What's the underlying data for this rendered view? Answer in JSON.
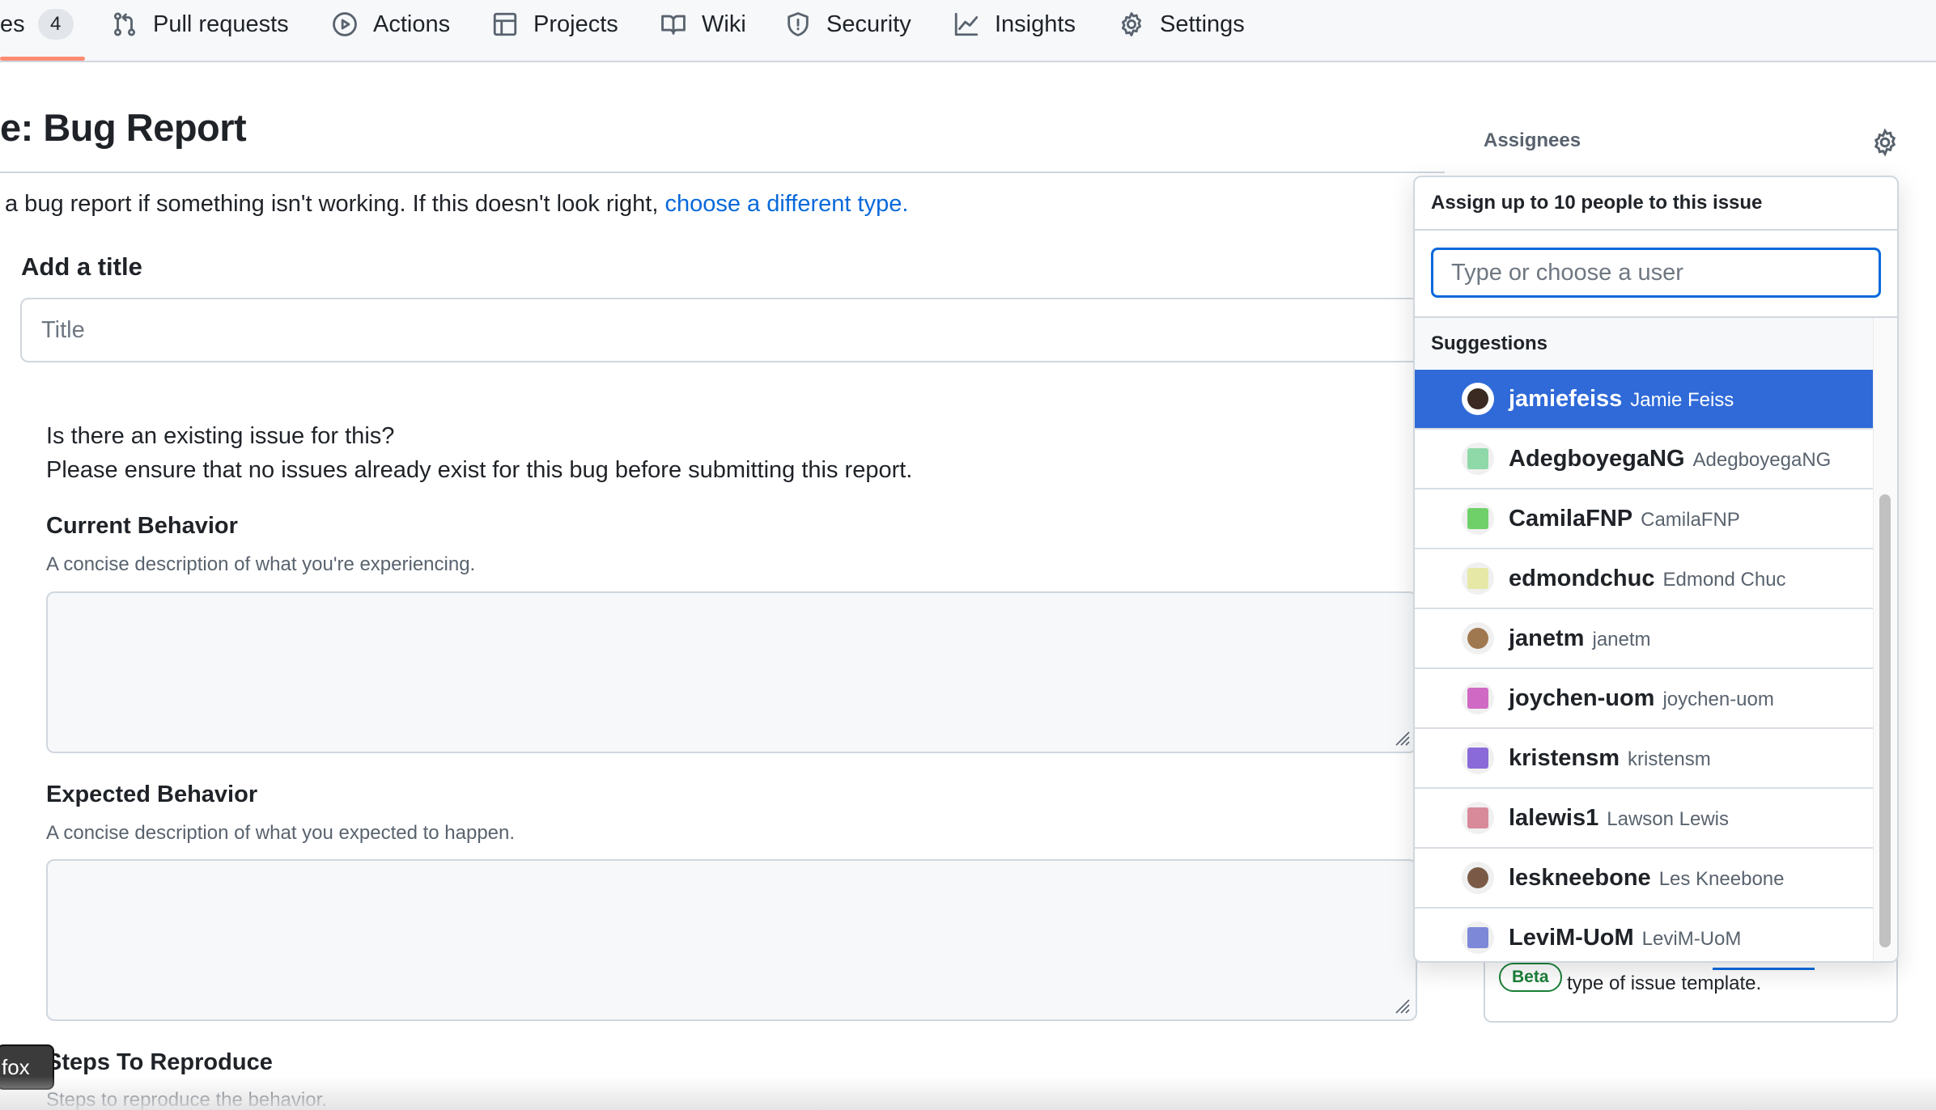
{
  "nav": {
    "issues_label": "es",
    "issues_count": "4",
    "items": [
      {
        "label": "Pull requests",
        "icon": "git-pull-request-icon"
      },
      {
        "label": "Actions",
        "icon": "play-icon"
      },
      {
        "label": "Projects",
        "icon": "table-icon"
      },
      {
        "label": "Wiki",
        "icon": "book-icon"
      },
      {
        "label": "Security",
        "icon": "shield-icon"
      },
      {
        "label": "Insights",
        "icon": "graph-icon"
      },
      {
        "label": "Settings",
        "icon": "gear-icon"
      }
    ]
  },
  "page": {
    "title": "e: Bug Report",
    "template_note": "a bug report if something isn't working. If this doesn't look right, ",
    "template_link": "choose a different type."
  },
  "form": {
    "add_title_label": "Add a title",
    "title_placeholder": "Title",
    "existing_issue_line1": "Is there an existing issue for this?",
    "existing_issue_line2": "Please ensure that no issues already exist for this bug before submitting this report.",
    "current_behavior_label": "Current Behavior",
    "current_behavior_desc": "A concise description of what you're experiencing.",
    "expected_behavior_label": "Expected Behavior",
    "expected_behavior_desc": "A concise description of what you expected to happen.",
    "steps_label": "Steps To Reproduce",
    "steps_desc": "Steps to reproduce the behavior."
  },
  "fox_tab": "fox",
  "sidebar": {
    "assignees_label": "Assignees",
    "beta_badge": "Beta",
    "card_text": "type of issue template."
  },
  "dropdown": {
    "header": "Assign up to 10 people to this issue",
    "filter_placeholder": "Type or choose a user",
    "suggestions_label": "Suggestions",
    "users": [
      {
        "login": "jamiefeiss",
        "name": "Jamie Feiss",
        "selected": true,
        "avatar_color": "#3a2a22"
      },
      {
        "login": "AdegboyegaNG",
        "name": "AdegboyegaNG",
        "avatar_color": "#8fd8a8"
      },
      {
        "login": "CamilaFNP",
        "name": "CamilaFNP",
        "avatar_color": "#6fd06a"
      },
      {
        "login": "edmondchuc",
        "name": "Edmond Chuc",
        "avatar_color": "#e6e8a6"
      },
      {
        "login": "janetm",
        "name": "janetm",
        "avatar_color": "#a07850"
      },
      {
        "login": "joychen-uom",
        "name": "joychen-uom",
        "avatar_color": "#d069c4"
      },
      {
        "login": "kristensm",
        "name": "kristensm",
        "avatar_color": "#8a6ad8"
      },
      {
        "login": "lalewis1",
        "name": "Lawson Lewis",
        "avatar_color": "#d88a9a"
      },
      {
        "login": "leskneebone",
        "name": "Les Kneebone",
        "avatar_color": "#7a5a46"
      },
      {
        "login": "LeviM-UoM",
        "name": "LeviM-UoM",
        "avatar_color": "#7e88d8"
      }
    ]
  }
}
